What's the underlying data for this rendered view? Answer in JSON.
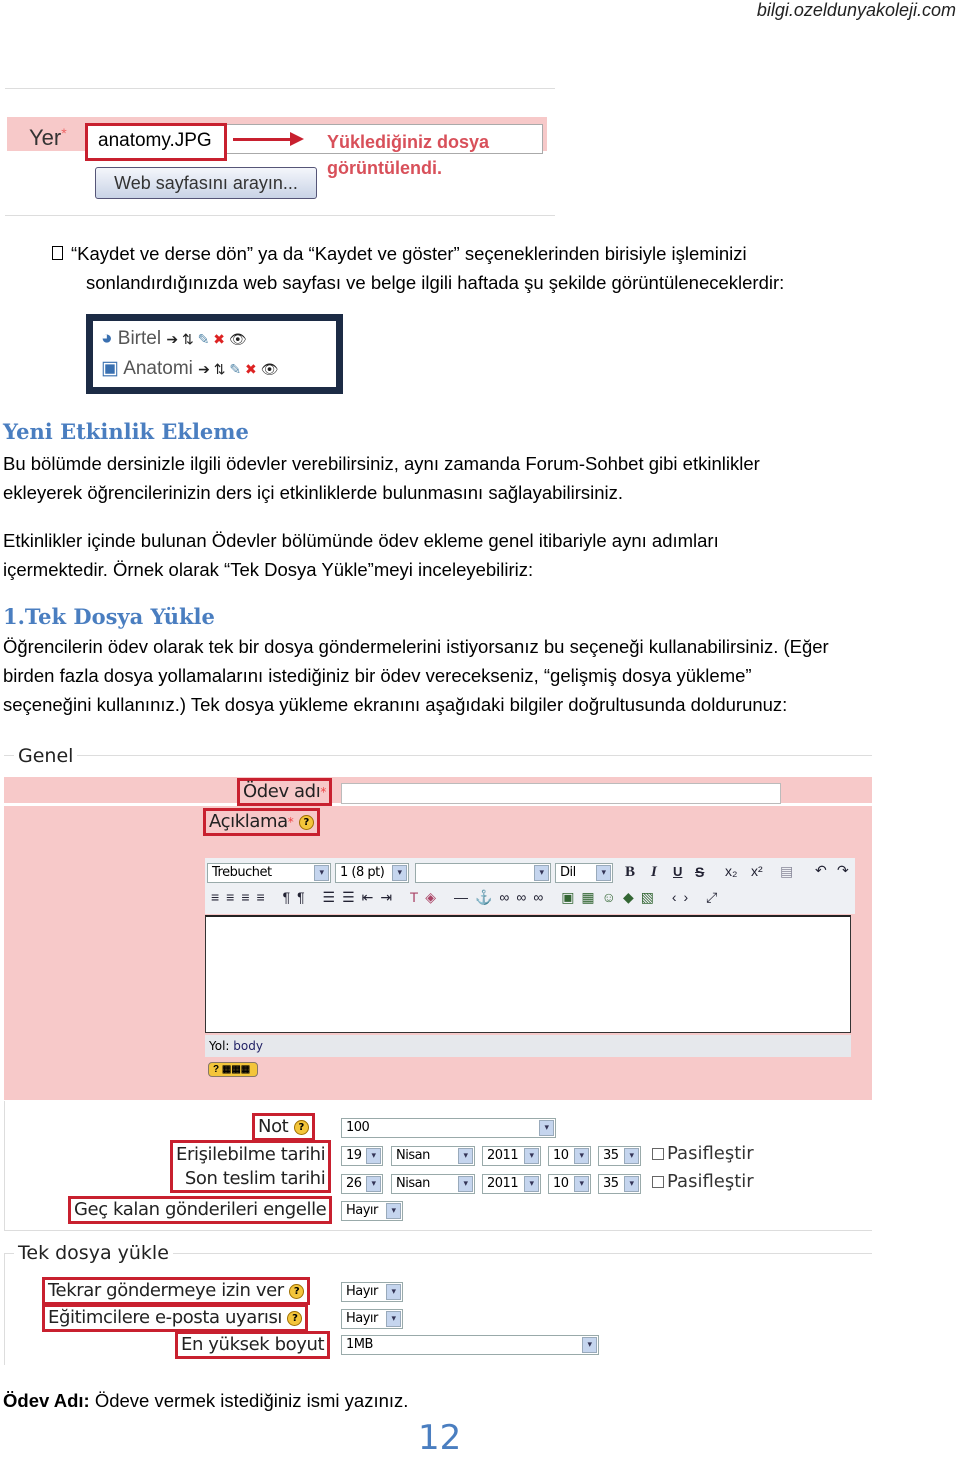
{
  "header": {
    "site": "bilgi.ozeldunyakoleji.com"
  },
  "shot_upload": {
    "label": "Yer",
    "required_mark": "*",
    "file_value": "anatomy.JPG",
    "browse_button": "Web sayfasını arayın...",
    "annotation": "Yüklediğiniz dosya görüntülendi."
  },
  "bullet": {
    "marker": "",
    "text1": "“Kaydet ve derse dön” ya da “Kaydet ve göster” seçeneklerinden birisiyle işleminizi",
    "text2": "sonlandırdığınızda web sayfası ve belge ilgili haftada şu şekilde görüntüleneceklerdir:"
  },
  "shot_list": {
    "items": [
      {
        "label": "Birtel"
      },
      {
        "label": "Anatomi"
      }
    ]
  },
  "section1": {
    "title": "Yeni Etkinlik Ekleme",
    "p1a": "Bu bölümde dersinizle ilgili ödevler verebilirsiniz, aynı zamanda Forum-Sohbet gibi etkinlikler",
    "p1b": "ekleyerek öğrencilerinizin ders içi etkinliklerde bulunmasını sağlayabilirsiniz.",
    "p2a": "Etkinlikler içinde bulunan Ödevler bölümünde ödev ekleme genel itibariyle aynı adımları",
    "p2b": "içermektedir. Örnek olarak “Tek Dosya Yükle”meyi inceleyebiliriz:"
  },
  "section2": {
    "title": "1.Tek Dosya Yükle",
    "p1a": "Öğrencilerin ödev olarak tek bir dosya göndermelerini istiyorsanız bu seçeneği kullanabilirsiniz. (Eğer",
    "p1b": "birden fazla dosya yollamalarını istediğiniz bir ödev verecekseniz, “gelişmiş dosya yükleme”",
    "p1c": "seçeneğini kullanınız.) Tek dosya yükleme ekranını aşağıdaki bilgiler doğrultusunda doldurunuz:"
  },
  "form": {
    "legend_general": "Genel",
    "assignment_name": "Ödev adı",
    "description": "Açıklama",
    "req": "*",
    "editor": {
      "font": "Trebuchet",
      "size": "1 (8 pt)",
      "lang": "Dil",
      "bold": "B",
      "italic": "I",
      "underline": "U",
      "strike": "S",
      "path_label": "Yol:",
      "path_value": "body"
    },
    "grade": {
      "label": "Not",
      "value": "100"
    },
    "available": {
      "label": "Erişilebilme tarihi",
      "day": "19",
      "month": "Nisan",
      "year": "2011",
      "hour": "10",
      "minute": "35",
      "disable": "Pasifleştir"
    },
    "due": {
      "label": "Son teslim tarihi",
      "day": "26",
      "month": "Nisan",
      "year": "2011",
      "hour": "10",
      "minute": "35",
      "disable": "Pasifleştir"
    },
    "prevent_late": {
      "label": "Geç kalan gönderileri engelle",
      "value": "Hayır"
    },
    "legend_upload": "Tek dosya yükle",
    "resubmit": {
      "label": "Tekrar göndermeye izin ver",
      "value": "Hayır"
    },
    "email": {
      "label": "Eğitimcilere e-posta uyarısı",
      "value": "Hayır"
    },
    "maxsize": {
      "label": "En yüksek boyut",
      "value": "1MB"
    }
  },
  "footer": {
    "note_label": "Ödev Adı:",
    "note_text": " Ödeve vermek istediğiniz ismi yazınız.",
    "page_number": "12"
  },
  "colors": {
    "heading": "#4a7ec0",
    "highlight_box": "#c8202f",
    "form_bg": "#f7c9c9"
  }
}
